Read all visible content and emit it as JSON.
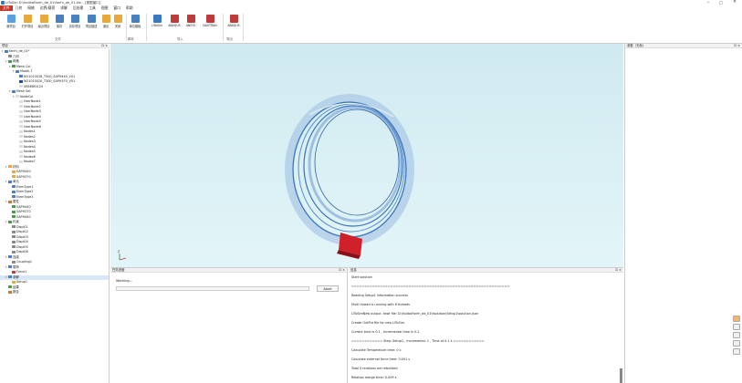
{
  "window": {
    "title": "LiToSim D:\\huilbaFanfn_de_01\\fanfn_de_01.ktn - [视图窗口]",
    "minimize": "–",
    "maximize": "□",
    "close": "✕"
  },
  "menu": [
    "文件",
    "几何",
    "网格",
    "边界/载荷",
    "求解",
    "后处理",
    "工具",
    "视图",
    "窗口",
    "帮助"
  ],
  "ribbon": {
    "buttons": [
      {
        "label": "新项目",
        "color": "#5aa0e0"
      },
      {
        "label": "打开项目",
        "color": "#e8a93a"
      },
      {
        "label": "最近项目",
        "color": "#e8a93a"
      },
      {
        "label": "保存",
        "color": "#4a7fc0"
      },
      {
        "label": "另存项目",
        "color": "#4a7fc0"
      },
      {
        "label": "项目描述",
        "color": "#4a7fc0"
      },
      {
        "label": "退出",
        "color": "#e8a93a"
      },
      {
        "label": "关闭",
        "color": "#e8a93a"
      },
      {
        "label": "单位模板",
        "color": "#4a7fc0"
      },
      {
        "label": "LiToSim",
        "color": "#3a78c0"
      },
      {
        "label": "ABAQUS",
        "color": "#c03a3a"
      },
      {
        "label": "ANSYS",
        "color": "#c03a3a"
      },
      {
        "label": "NASTRAN",
        "color": "#c03a3a"
      },
      {
        "label": "ABAQUS",
        "color": "#c03a3a"
      }
    ],
    "groups": [
      "文件",
      "脚本",
      "导入",
      "导出"
    ]
  },
  "tree": {
    "header": "项目",
    "pins": "⊡ ×",
    "rows": [
      {
        "indent": 0,
        "twist": "▾",
        "label": "fanfn_de_01*",
        "color": "#4a7fc0"
      },
      {
        "indent": 1,
        "twist": "",
        "label": "几何",
        "color": "#888"
      },
      {
        "indent": 1,
        "twist": "▾",
        "label": "网格",
        "color": "#4a9a4a"
      },
      {
        "indent": 2,
        "twist": "▾",
        "label": "Mesh Col",
        "color": "#4a9a4a"
      },
      {
        "indent": 3,
        "twist": "▾",
        "label": "Model-7",
        "color": "#4a7fc0"
      },
      {
        "indent": 4,
        "twist": "",
        "label": "NO1010018_T500_SAPH440_V01",
        "color": "#4a7fc0"
      },
      {
        "indent": 4,
        "twist": "",
        "label": "NO1010020_T300_SAPH370_V01",
        "color": "#1a4f90"
      },
      {
        "indent": 4,
        "twist": "",
        "label": "SEBMM0120",
        "color": "#ddd"
      },
      {
        "indent": 2,
        "twist": "▾",
        "label": "Mesh Set",
        "color": "#4a7fc0"
      },
      {
        "indent": 3,
        "twist": "▾",
        "label": "NodeCol",
        "color": "#ddd"
      },
      {
        "indent": 4,
        "twist": "",
        "label": "UserNode1",
        "color": "#ddd"
      },
      {
        "indent": 4,
        "twist": "",
        "label": "UserNode2",
        "color": "#ddd"
      },
      {
        "indent": 4,
        "twist": "",
        "label": "UserNode3",
        "color": "#ddd"
      },
      {
        "indent": 4,
        "twist": "",
        "label": "UserNode4",
        "color": "#ddd"
      },
      {
        "indent": 4,
        "twist": "",
        "label": "UserNode5",
        "color": "#ddd"
      },
      {
        "indent": 4,
        "twist": "",
        "label": "UserNode6",
        "color": "#ddd"
      },
      {
        "indent": 4,
        "twist": "",
        "label": "Nodes1",
        "color": "#ddd"
      },
      {
        "indent": 4,
        "twist": "",
        "label": "Nodes2",
        "color": "#ddd"
      },
      {
        "indent": 4,
        "twist": "",
        "label": "Nodes3",
        "color": "#ddd"
      },
      {
        "indent": 4,
        "twist": "",
        "label": "Nodes4",
        "color": "#ddd"
      },
      {
        "indent": 4,
        "twist": "",
        "label": "Nodes5",
        "color": "#ddd"
      },
      {
        "indent": 4,
        "twist": "",
        "label": "Nodes6",
        "color": "#ddd"
      },
      {
        "indent": 4,
        "twist": "",
        "label": "Nodes7",
        "color": "#ddd"
      },
      {
        "indent": 1,
        "twist": "▾",
        "label": "材料",
        "color": "#e8a93a"
      },
      {
        "indent": 2,
        "twist": "",
        "label": "SAPH440",
        "color": "#e8a93a"
      },
      {
        "indent": 2,
        "twist": "",
        "label": "SAPH370",
        "color": "#e8a93a"
      },
      {
        "indent": 1,
        "twist": "▾",
        "label": "单元",
        "color": "#4a7fc0"
      },
      {
        "indent": 2,
        "twist": "",
        "label": "ElemType1",
        "color": "#4a7fc0"
      },
      {
        "indent": 2,
        "twist": "",
        "label": "ElemType2",
        "color": "#4a7fc0"
      },
      {
        "indent": 2,
        "twist": "",
        "label": "ElemType3",
        "color": "#4a7fc0"
      },
      {
        "indent": 1,
        "twist": "▾",
        "label": "属性",
        "color": "#c07a3a"
      },
      {
        "indent": 2,
        "twist": "",
        "label": "SAPH440",
        "color": "#4a9a4a"
      },
      {
        "indent": 2,
        "twist": "",
        "label": "SAPH370",
        "color": "#4a9a4a"
      },
      {
        "indent": 2,
        "twist": "",
        "label": "SAPH440",
        "color": "#4a9a4a"
      },
      {
        "indent": 1,
        "twist": "▾",
        "label": "约束",
        "color": "#4a9a4a"
      },
      {
        "indent": 2,
        "twist": "",
        "label": "Displ01",
        "color": "#888"
      },
      {
        "indent": 2,
        "twist": "",
        "label": "Displ02",
        "color": "#888"
      },
      {
        "indent": 2,
        "twist": "",
        "label": "Displ03",
        "color": "#888"
      },
      {
        "indent": 2,
        "twist": "",
        "label": "Displ04",
        "color": "#888"
      },
      {
        "indent": 2,
        "twist": "",
        "label": "Displ05",
        "color": "#888"
      },
      {
        "indent": 2,
        "twist": "",
        "label": "Displ06",
        "color": "#888"
      },
      {
        "indent": 1,
        "twist": "▾",
        "label": "连接",
        "color": "#4a7fc0"
      },
      {
        "indent": 2,
        "twist": "",
        "label": "Coupling1",
        "color": "#888"
      },
      {
        "indent": 1,
        "twist": "▾",
        "label": "载荷",
        "color": "#4a7fc0"
      },
      {
        "indent": 2,
        "twist": "",
        "label": "Force1",
        "color": "#c03a3a"
      },
      {
        "indent": 1,
        "twist": "▾",
        "label": "求解",
        "color": "#4a7fc0",
        "selected": true
      },
      {
        "indent": 2,
        "twist": "",
        "label": "Setup1",
        "color": "#e8a93a"
      },
      {
        "indent": 1,
        "twist": "",
        "label": "结果",
        "color": "#4a9a4a"
      },
      {
        "indent": 1,
        "twist": "",
        "label": "报告",
        "color": "#c07a3a"
      }
    ]
  },
  "viewport": {
    "axis_label": "Z"
  },
  "right_panel": {
    "header": "参数（无标)",
    "pins": "⊡ ×"
  },
  "progress_panel": {
    "header": "任务进度",
    "pins": "⊡ ×",
    "status": "Working...",
    "abort_label": "Abort"
  },
  "info_panel": {
    "header": "信息",
    "pins": "⊡ ×",
    "lines": [
      "Start solution",
      "=============================================================",
      "Reading Setup1 information success",
      "Multi thread is running with 6 threads",
      "LiToSimNew output .hswf file: D:\\huilbaFanfn_de_01\\fsolution\\Setup1\\solution.json",
      "Create OutPut file for new LiToSim.",
      "Current time is 0.1 , Incremental time is 0.1",
      "============ Step: Setup1 , Incremental: 1 , Time at 0.1 s ============",
      "Calculate Temperature time: 0  s",
      "Calculate external force time: 0.001  s",
      "Total 0 relations are rebuilded",
      "Relation merge time: 0.009  s"
    ]
  },
  "colors": {
    "accent": "#c0392b",
    "viewport_top": "#cfeaf0",
    "ring": "#3a74b8",
    "block": "#d0202a"
  }
}
